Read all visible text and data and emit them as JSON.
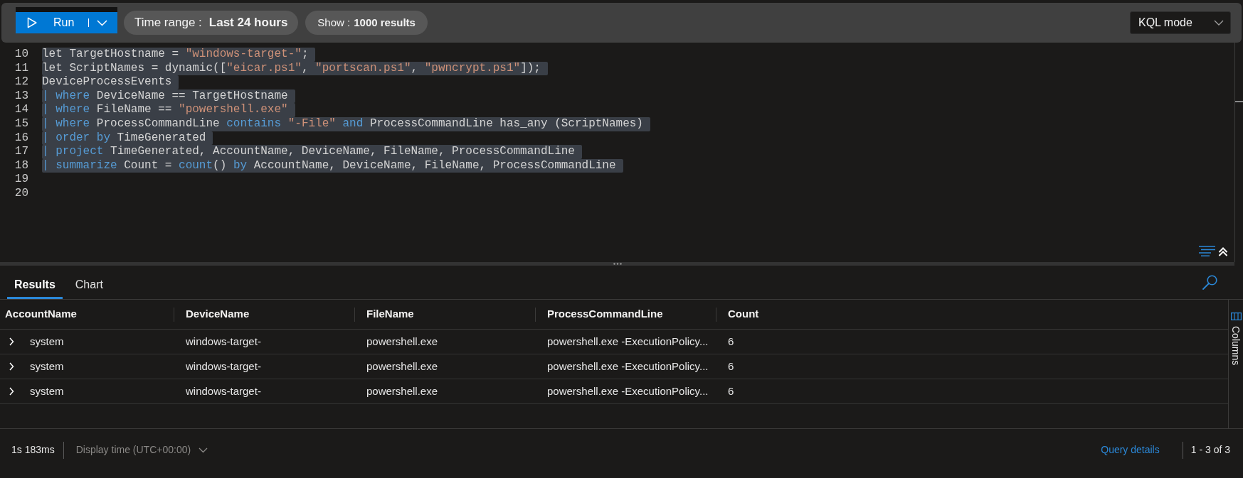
{
  "toolbar": {
    "run_button": {
      "label": "Run"
    },
    "time_range": {
      "label": "Time range :",
      "value": "Last 24 hours"
    },
    "result_limit": {
      "label": "Show :",
      "value": "1000 results"
    },
    "mode_dropdown": {
      "value": "KQL mode"
    }
  },
  "editor": {
    "lines": [
      {
        "number": "10",
        "selected": true,
        "tokens": [
          {
            "kind": "plain",
            "text": "let TargetHostname = "
          },
          {
            "kind": "string",
            "text": "\"windows-target-\""
          },
          {
            "kind": "plain",
            "text": ";"
          }
        ]
      },
      {
        "number": "11",
        "selected": true,
        "tokens": [
          {
            "kind": "plain",
            "text": "let ScriptNames = dynamic(["
          },
          {
            "kind": "string",
            "text": "\"eicar.ps1\""
          },
          {
            "kind": "plain",
            "text": ", "
          },
          {
            "kind": "string",
            "text": "\"portscan.ps1\""
          },
          {
            "kind": "plain",
            "text": ", "
          },
          {
            "kind": "string",
            "text": "\"pwncrypt.ps1\""
          },
          {
            "kind": "plain",
            "text": "]);"
          }
        ]
      },
      {
        "number": "12",
        "selected": true,
        "tokens": [
          {
            "kind": "plain",
            "text": "DeviceProcessEvents"
          }
        ]
      },
      {
        "number": "13",
        "selected": true,
        "tokens": [
          {
            "kind": "keyword",
            "text": "| where"
          },
          {
            "kind": "plain",
            "text": " DeviceName == TargetHostname"
          }
        ]
      },
      {
        "number": "14",
        "selected": true,
        "tokens": [
          {
            "kind": "keyword",
            "text": "| where"
          },
          {
            "kind": "plain",
            "text": " FileName == "
          },
          {
            "kind": "string",
            "text": "\"powershell.exe\""
          }
        ]
      },
      {
        "number": "15",
        "selected": true,
        "tokens": [
          {
            "kind": "keyword",
            "text": "| where"
          },
          {
            "kind": "plain",
            "text": " ProcessCommandLine "
          },
          {
            "kind": "keyword",
            "text": "contains "
          },
          {
            "kind": "string",
            "text": "\"-File\""
          },
          {
            "kind": "keyword",
            "text": " and"
          },
          {
            "kind": "plain",
            "text": " ProcessCommandLine has_any (ScriptNames)"
          }
        ]
      },
      {
        "number": "16",
        "selected": true,
        "tokens": [
          {
            "kind": "keyword",
            "text": "| order by"
          },
          {
            "kind": "plain",
            "text": " TimeGenerated"
          }
        ]
      },
      {
        "number": "17",
        "selected": true,
        "tokens": [
          {
            "kind": "keyword",
            "text": "| project"
          },
          {
            "kind": "plain",
            "text": " TimeGenerated, AccountName, DeviceName, FileName, ProcessCommandLine"
          }
        ]
      },
      {
        "number": "18",
        "selected": true,
        "tokens": [
          {
            "kind": "keyword",
            "text": "| summarize"
          },
          {
            "kind": "plain",
            "text": " Count = "
          },
          {
            "kind": "keyword",
            "text": "count"
          },
          {
            "kind": "plain",
            "text": "() "
          },
          {
            "kind": "keyword",
            "text": "by"
          },
          {
            "kind": "plain",
            "text": " AccountName, DeviceName, FileName, ProcessCommandLine"
          }
        ]
      },
      {
        "number": "19",
        "selected": false
      },
      {
        "number": "20",
        "selected": false
      }
    ]
  },
  "results_tabs": [
    {
      "label": "Results",
      "selected": true
    },
    {
      "label": "Chart",
      "selected": false
    }
  ],
  "table": {
    "columns": [
      "AccountName",
      "DeviceName",
      "FileName",
      "ProcessCommandLine",
      "Count"
    ],
    "rows": [
      {
        "expanded": false,
        "cells": [
          "system",
          "windows-target-",
          "powershell.exe",
          "powershell.exe -ExecutionPolicy...",
          "6"
        ]
      },
      {
        "expanded": false,
        "cells": [
          "system",
          "windows-target-",
          "powershell.exe",
          "powershell.exe -ExecutionPolicy...",
          "6"
        ]
      },
      {
        "expanded": false,
        "cells": [
          "system",
          "windows-target-",
          "powershell.exe",
          "powershell.exe -ExecutionPolicy...",
          "6"
        ]
      }
    ]
  },
  "columns_panel": {
    "label": "Columns"
  },
  "status_bar": {
    "duration": "1s 183ms",
    "display_time": "Display time (UTC+00:00)",
    "query_details": "Query details",
    "result_range": "1 - 3 of 3"
  }
}
